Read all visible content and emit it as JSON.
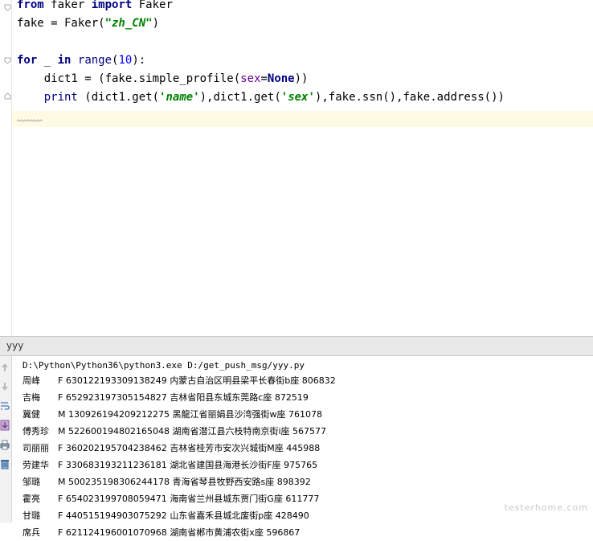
{
  "editor": {
    "lines": [
      {
        "segments": [
          {
            "t": "from",
            "c": "kw"
          },
          {
            "t": " faker ",
            "c": ""
          },
          {
            "t": "import",
            "c": "kw"
          },
          {
            "t": " Faker",
            "c": ""
          }
        ]
      },
      {
        "segments": [
          {
            "t": "fake = Faker(",
            "c": ""
          },
          {
            "t": "\"zh_CN\"",
            "c": "str"
          },
          {
            "t": ")",
            "c": ""
          }
        ]
      },
      {
        "segments": []
      },
      {
        "segments": [
          {
            "t": "for",
            "c": "kw"
          },
          {
            "t": " _ ",
            "c": ""
          },
          {
            "t": "in",
            "c": "kw"
          },
          {
            "t": " ",
            "c": ""
          },
          {
            "t": "range",
            "c": "builtin"
          },
          {
            "t": "(",
            "c": ""
          },
          {
            "t": "10",
            "c": "num"
          },
          {
            "t": "):",
            "c": ""
          }
        ]
      },
      {
        "segments": [
          {
            "t": "    dict1 = (fake.simple_profile(",
            "c": ""
          },
          {
            "t": "sex",
            "c": "param"
          },
          {
            "t": "=",
            "c": ""
          },
          {
            "t": "None",
            "c": "kw"
          },
          {
            "t": "))",
            "c": ""
          }
        ]
      },
      {
        "segments": [
          {
            "t": "    ",
            "c": ""
          },
          {
            "t": "print",
            "c": "builtin"
          },
          {
            "t": " (dict1.get(",
            "c": ""
          },
          {
            "t": "'name'",
            "c": "str"
          },
          {
            "t": "),dict1.get(",
            "c": ""
          },
          {
            "t": "'sex'",
            "c": "str"
          },
          {
            "t": "),fake.ssn(),fake.address())",
            "c": ""
          }
        ]
      }
    ]
  },
  "run_panel": {
    "title": "yyy",
    "command": "D:\\Python\\Python36\\python3.exe D:/get_push_msg/yyy.py",
    "rows": [
      {
        "name": "周峰",
        "sex": "F",
        "ssn": "630122193309138249",
        "address": "内蒙古自治区明县梁平长春街b座 806832"
      },
      {
        "name": "吉梅",
        "sex": "F",
        "ssn": "652923197305154827",
        "address": "吉林省阳县东城东莞路c座 872519"
      },
      {
        "name": "冀健",
        "sex": "M",
        "ssn": "130926194209212275",
        "address": "黑龍江省丽娟县沙湾强街w座 761078"
      },
      {
        "name": "傅秀珍",
        "sex": "M",
        "ssn": "522600194802165048",
        "address": "湖南省潜江县六枝特南京街i座 567577"
      },
      {
        "name": "司丽丽",
        "sex": "F",
        "ssn": "360202195704238462",
        "address": "吉林省桂芳市安次兴城街M座 445988"
      },
      {
        "name": "劳建华",
        "sex": "F",
        "ssn": "330683193211236181",
        "address": "湖北省建国县海港长沙街F座 975765"
      },
      {
        "name": "邹璐",
        "sex": "M",
        "ssn": "500235198306244178",
        "address": "青海省琴县牧野西安路s座 898392"
      },
      {
        "name": "霍亮",
        "sex": "F",
        "ssn": "654023199708059471",
        "address": "海南省兰州县城东贾门街G座 611777"
      },
      {
        "name": "甘璐",
        "sex": "F",
        "ssn": "440515194903075292",
        "address": "山东省嘉禾县城北废街p座 428490"
      },
      {
        "name": "席兵",
        "sex": "F",
        "ssn": "621124196001070968",
        "address": "湖南省郴市黄浦农街x座 596867"
      }
    ]
  },
  "watermark": "testerhome.com",
  "colors": {
    "keyword": "#000080",
    "string": "#008000",
    "number": "#0000ff",
    "caret_line": "#fffae3"
  },
  "icons": [
    "fold-icon",
    "rerun-icon",
    "stop-icon",
    "soft-wrap-icon",
    "scroll-to-end-icon",
    "print-icon",
    "trash-icon"
  ]
}
